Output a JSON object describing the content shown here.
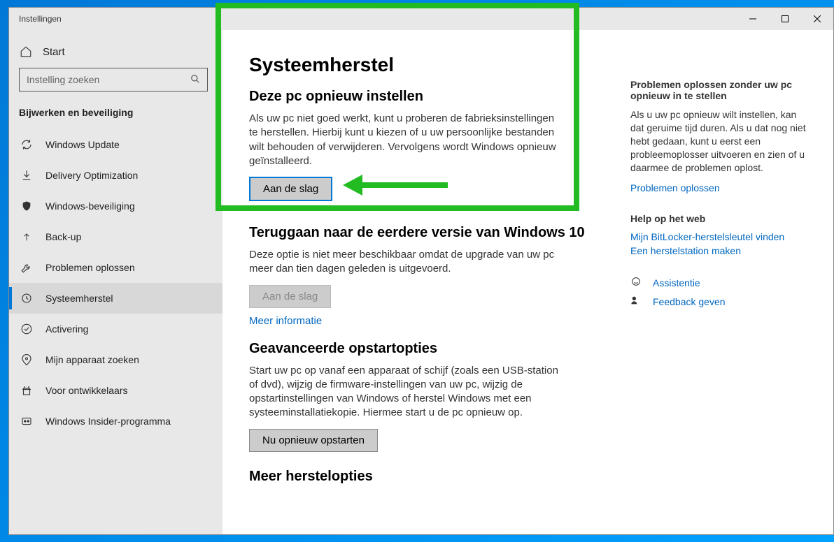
{
  "titlebar": {
    "title": "Instellingen"
  },
  "sidebar": {
    "home": "Start",
    "search_placeholder": "Instelling zoeken",
    "category": "Bijwerken en beveiliging",
    "items": [
      {
        "label": "Windows Update"
      },
      {
        "label": "Delivery Optimization"
      },
      {
        "label": "Windows-beveiliging"
      },
      {
        "label": "Back-up"
      },
      {
        "label": "Problemen oplossen"
      },
      {
        "label": "Systeemherstel"
      },
      {
        "label": "Activering"
      },
      {
        "label": "Mijn apparaat zoeken"
      },
      {
        "label": "Voor ontwikkelaars"
      },
      {
        "label": "Windows Insider-programma"
      }
    ]
  },
  "content": {
    "page_title": "Systeemherstel",
    "reset": {
      "heading": "Deze pc opnieuw instellen",
      "body": "Als uw pc niet goed werkt, kunt u proberen de fabrieksinstellingen te herstellen. Hierbij kunt u kiezen of u uw persoonlijke bestanden wilt behouden of verwijderen. Vervolgens wordt Windows opnieuw geïnstalleerd.",
      "button": "Aan de slag"
    },
    "goback": {
      "heading": "Teruggaan naar de eerdere versie van Windows 10",
      "body": "Deze optie is niet meer beschikbaar omdat de upgrade van uw pc meer dan tien dagen geleden is uitgevoerd.",
      "button": "Aan de slag",
      "link": "Meer informatie"
    },
    "advanced": {
      "heading": "Geavanceerde opstartopties",
      "body": "Start uw pc op vanaf een apparaat of schijf (zoals een USB-station of dvd), wijzig de firmware-instellingen van uw pc, wijzig de opstartinstellingen van Windows of herstel Windows met een systeeminstallatiekopie. Hiermee start u de pc opnieuw op.",
      "button": "Nu opnieuw opstarten"
    },
    "more": {
      "heading": "Meer herstelopties"
    }
  },
  "right": {
    "help1": {
      "heading": "Problemen oplossen zonder uw pc opnieuw in te stellen",
      "body": "Als u uw pc opnieuw wilt instellen, kan dat geruime tijd duren. Als u dat nog niet hebt gedaan, kunt u eerst een probleemoplosser uitvoeren en zien of u daarmee de problemen oplost.",
      "link": "Problemen oplossen"
    },
    "web": {
      "heading": "Help op het web",
      "link1": "Mijn BitLocker-herstelsleutel vinden",
      "link2": "Een herstelstation maken"
    },
    "support": {
      "link1": "Assistentie",
      "link2": "Feedback geven"
    }
  }
}
